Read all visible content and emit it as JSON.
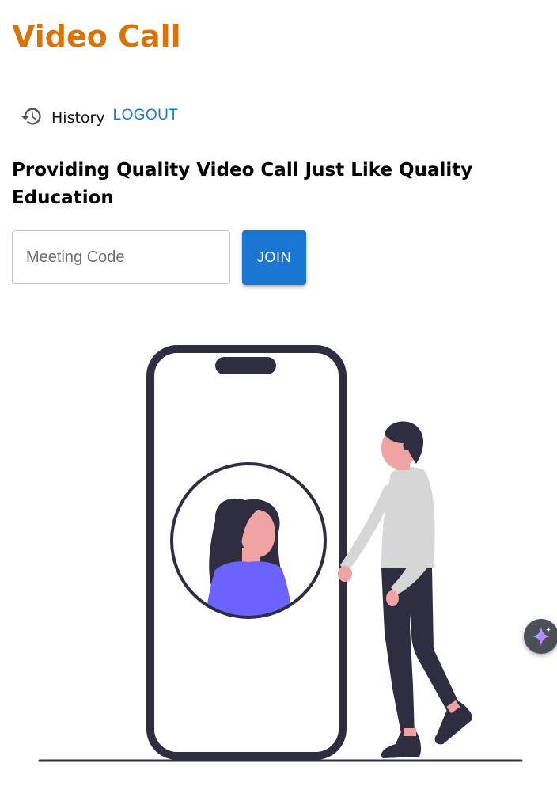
{
  "header": {
    "app_title": "Video Call"
  },
  "nav": {
    "history_label": "History",
    "logout_label": "LOGOUT",
    "history_icon": "history-icon"
  },
  "main": {
    "tagline": "Providing Quality Video Call Just Like Quality Education",
    "meeting_input": {
      "placeholder": "Meeting Code",
      "value": ""
    },
    "join_label": "JOIN"
  },
  "colors": {
    "brand_orange": "#d97309",
    "primary_blue": "#1976d2",
    "illustration_dark": "#2f2e41",
    "avatar_purple": "#6c63ff",
    "skin": "#f0a3a3",
    "shirt_gray": "#d6d6d6"
  },
  "floating": {
    "assistant_icon": "sparkle-icon"
  }
}
